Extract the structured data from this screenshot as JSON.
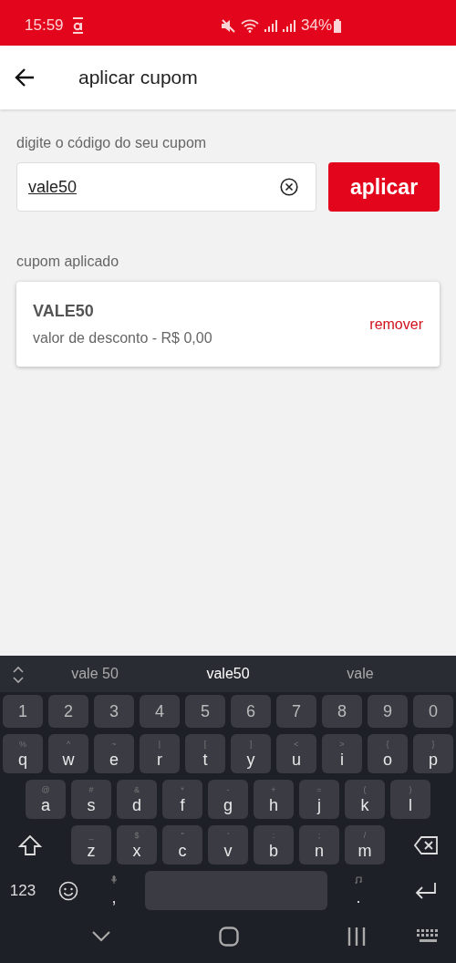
{
  "status_bar": {
    "time": "15:59",
    "battery": "34%"
  },
  "header": {
    "title": "aplicar cupom"
  },
  "form": {
    "label": "digite o código do seu cupom",
    "value": "vale50",
    "button": "aplicar"
  },
  "applied": {
    "label": "cupom aplicado",
    "code": "VALE50",
    "discount": "valor de desconto - R$ 0,00",
    "remove": "remover"
  },
  "keyboard": {
    "suggestions": [
      {
        "text": "vale 50",
        "selected": false
      },
      {
        "text": "vale50",
        "selected": true
      },
      {
        "text": "vale",
        "selected": false
      }
    ],
    "rows": [
      [
        {
          "kind": "char",
          "key": "1"
        },
        {
          "kind": "char",
          "key": "2"
        },
        {
          "kind": "char",
          "key": "3"
        },
        {
          "kind": "char",
          "key": "4"
        },
        {
          "kind": "char",
          "key": "5"
        },
        {
          "kind": "char",
          "key": "6"
        },
        {
          "kind": "char",
          "key": "7"
        },
        {
          "kind": "char",
          "key": "8"
        },
        {
          "kind": "char",
          "key": "9"
        },
        {
          "kind": "char",
          "key": "0"
        }
      ],
      [
        {
          "kind": "char",
          "key": "q",
          "hint": "%"
        },
        {
          "kind": "char",
          "key": "w",
          "hint": "^"
        },
        {
          "kind": "char",
          "key": "e",
          "hint": "~"
        },
        {
          "kind": "char",
          "key": "r",
          "hint": "|"
        },
        {
          "kind": "char",
          "key": "t",
          "hint": "["
        },
        {
          "kind": "char",
          "key": "y",
          "hint": "]"
        },
        {
          "kind": "char",
          "key": "u",
          "hint": "<"
        },
        {
          "kind": "char",
          "key": "i",
          "hint": ">"
        },
        {
          "kind": "char",
          "key": "o",
          "hint": "{"
        },
        {
          "kind": "char",
          "key": "p",
          "hint": "}"
        }
      ],
      [
        {
          "kind": "char",
          "key": "a",
          "hint": "@"
        },
        {
          "kind": "char",
          "key": "s",
          "hint": "#"
        },
        {
          "kind": "char",
          "key": "d",
          "hint": "&"
        },
        {
          "kind": "char",
          "key": "f",
          "hint": "*"
        },
        {
          "kind": "char",
          "key": "g",
          "hint": "-"
        },
        {
          "kind": "char",
          "key": "h",
          "hint": "+"
        },
        {
          "kind": "char",
          "key": "j",
          "hint": "="
        },
        {
          "kind": "char",
          "key": "k",
          "hint": "("
        },
        {
          "kind": "char",
          "key": "l",
          "hint": ")"
        }
      ],
      [
        {
          "kind": "shift"
        },
        {
          "kind": "char",
          "key": "z",
          "hint": "_"
        },
        {
          "kind": "char",
          "key": "x",
          "hint": "$"
        },
        {
          "kind": "char",
          "key": "c",
          "hint": "\""
        },
        {
          "kind": "char",
          "key": "v",
          "hint": "'"
        },
        {
          "kind": "char",
          "key": "b",
          "hint": ":"
        },
        {
          "kind": "char",
          "key": "n",
          "hint": ";"
        },
        {
          "kind": "char",
          "key": "m",
          "hint": "/"
        },
        {
          "kind": "backspace"
        }
      ],
      [
        {
          "kind": "label",
          "key": "123"
        },
        {
          "kind": "emoji"
        },
        {
          "kind": "mic",
          "key": ","
        },
        {
          "kind": "space"
        },
        {
          "kind": "music",
          "key": "."
        },
        {
          "kind": "enter"
        }
      ]
    ]
  }
}
